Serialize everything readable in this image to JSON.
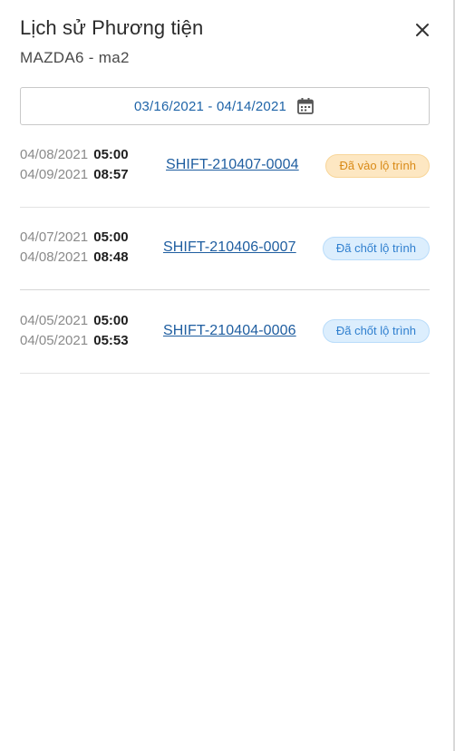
{
  "header": {
    "title": "Lịch sử Phương tiện",
    "subtitle": "MAZDA6 - ma2",
    "close_icon": "close-icon"
  },
  "date_filter": {
    "range": "03/16/2021 - 04/14/2021",
    "icon": "calendar-icon"
  },
  "rows": [
    {
      "start_date": "04/08/2021",
      "start_time": "05:00",
      "end_date": "04/09/2021",
      "end_time": "08:57",
      "shift_code": "SHIFT-210407-0004",
      "status": "Đã vào lộ trình",
      "status_color": "#d98a17"
    },
    {
      "start_date": "04/07/2021",
      "start_time": "05:00",
      "end_date": "04/08/2021",
      "end_time": "08:48",
      "shift_code": "SHIFT-210406-0007",
      "status": "Đã chốt lộ trình",
      "status_color": "#2f7fcf"
    },
    {
      "start_date": "04/05/2021",
      "start_time": "05:00",
      "end_date": "04/05/2021",
      "end_time": "05:53",
      "shift_code": "SHIFT-210404-0006",
      "status": "Đã chốt lộ trình",
      "status_color": "#2f7fcf"
    }
  ]
}
